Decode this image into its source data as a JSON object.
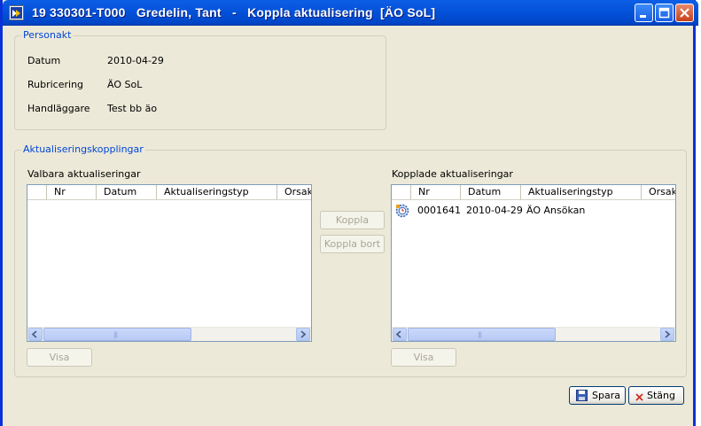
{
  "window": {
    "title": "19 330301-T000   Gredelin, Tant   -   Koppla aktualisering  [ÄO SoL]"
  },
  "personakt": {
    "legend": "Personakt",
    "fields": [
      {
        "label": "Datum",
        "value": "2010-04-29"
      },
      {
        "label": "Rubricering",
        "value": "ÄO SoL"
      },
      {
        "label": "Handläggare",
        "value": "Test bb äo"
      }
    ]
  },
  "kopplingar": {
    "legend": "Aktualiseringskopplingar",
    "valbara": {
      "title": "Valbara aktualiseringar",
      "columns": [
        "",
        "Nr",
        "Datum",
        "Aktualiseringstyp",
        "Orsak"
      ],
      "rows": [],
      "visa_label": "Visa"
    },
    "kopplade": {
      "title": "Kopplade aktualiseringar",
      "columns": [
        "",
        "Nr",
        "Datum",
        "Aktualiseringstyp",
        "Orsak"
      ],
      "rows": [
        {
          "icon": "gear-clock-icon",
          "nr": "0001641",
          "datum": "2010-04-29",
          "typ": "ÄO Ansökan"
        }
      ],
      "visa_label": "Visa"
    },
    "koppla_label": "Koppla",
    "koppla_bort_label": "Koppla bort"
  },
  "footer": {
    "spara_label": "Spara",
    "stang_label": "Stäng"
  },
  "colors": {
    "titlebar": "#0350D8",
    "legend_text": "#0046D5",
    "window_bg": "#ECE9D8"
  }
}
